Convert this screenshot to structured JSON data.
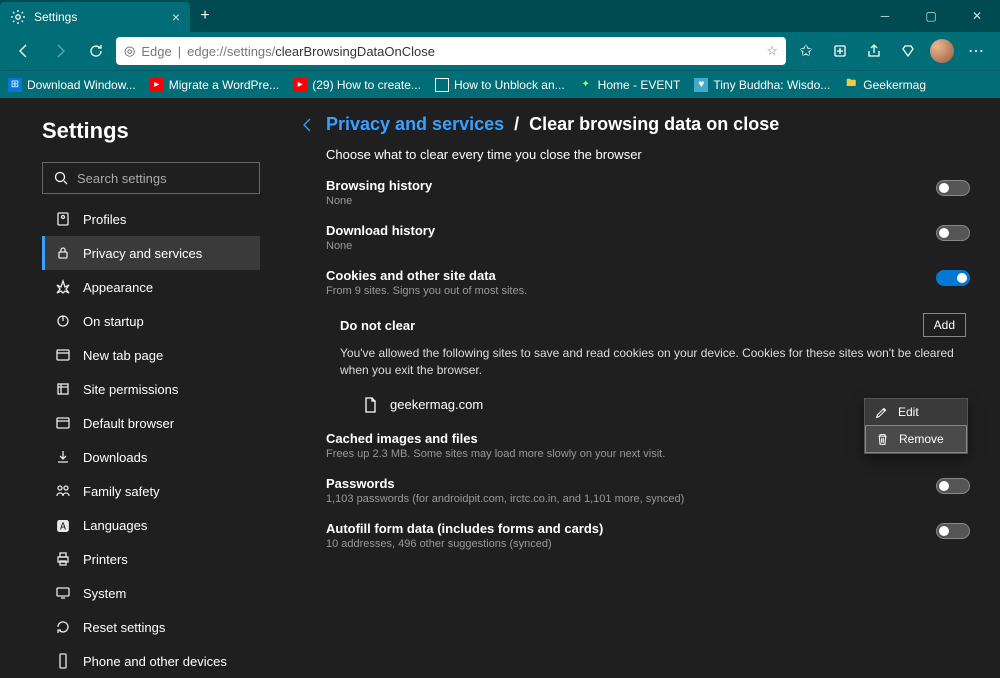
{
  "tab": {
    "title": "Settings"
  },
  "addressbar": {
    "proto": "Edge",
    "grey": "edge://settings/",
    "path": "clearBrowsingDataOnClose"
  },
  "bookmarks": [
    {
      "label": "Download Window..."
    },
    {
      "label": "Migrate a WordPre..."
    },
    {
      "label": "(29) How to create..."
    },
    {
      "label": "How to Unblock an..."
    },
    {
      "label": "Home - EVENT"
    },
    {
      "label": "Tiny Buddha: Wisdo..."
    },
    {
      "label": "Geekermag"
    }
  ],
  "sidebar": {
    "title": "Settings",
    "search_placeholder": "Search settings",
    "items": [
      {
        "label": "Profiles"
      },
      {
        "label": "Privacy and services"
      },
      {
        "label": "Appearance"
      },
      {
        "label": "On startup"
      },
      {
        "label": "New tab page"
      },
      {
        "label": "Site permissions"
      },
      {
        "label": "Default browser"
      },
      {
        "label": "Downloads"
      },
      {
        "label": "Family safety"
      },
      {
        "label": "Languages"
      },
      {
        "label": "Printers"
      },
      {
        "label": "System"
      },
      {
        "label": "Reset settings"
      },
      {
        "label": "Phone and other devices"
      }
    ]
  },
  "crumb": {
    "link": "Privacy and services",
    "sep": "/",
    "page": "Clear browsing data on close"
  },
  "desc": "Choose what to clear every time you close the browser",
  "settings": {
    "browsing": {
      "title": "Browsing history",
      "sub": "None"
    },
    "download": {
      "title": "Download history",
      "sub": "None"
    },
    "cookies": {
      "title": "Cookies and other site data",
      "sub": "From 9 sites. Signs you out of most sites."
    },
    "cached": {
      "title": "Cached images and files",
      "sub": "Frees up 2.3 MB. Some sites may load more slowly on your next visit."
    },
    "passwords": {
      "title": "Passwords",
      "sub": "1,103 passwords (for androidpit.com, irctc.co.in, and 1,101 more, synced)"
    },
    "autofill": {
      "title": "Autofill form data (includes forms and cards)",
      "sub": "10 addresses, 496 other suggestions (synced)"
    }
  },
  "dnc": {
    "title": "Do not clear",
    "add": "Add",
    "desc": "You've allowed the following sites to save and read cookies on your device. Cookies for these sites won't be cleared when you exit the browser.",
    "site": "geekermag.com"
  },
  "ctx": {
    "edit": "Edit",
    "remove": "Remove"
  }
}
